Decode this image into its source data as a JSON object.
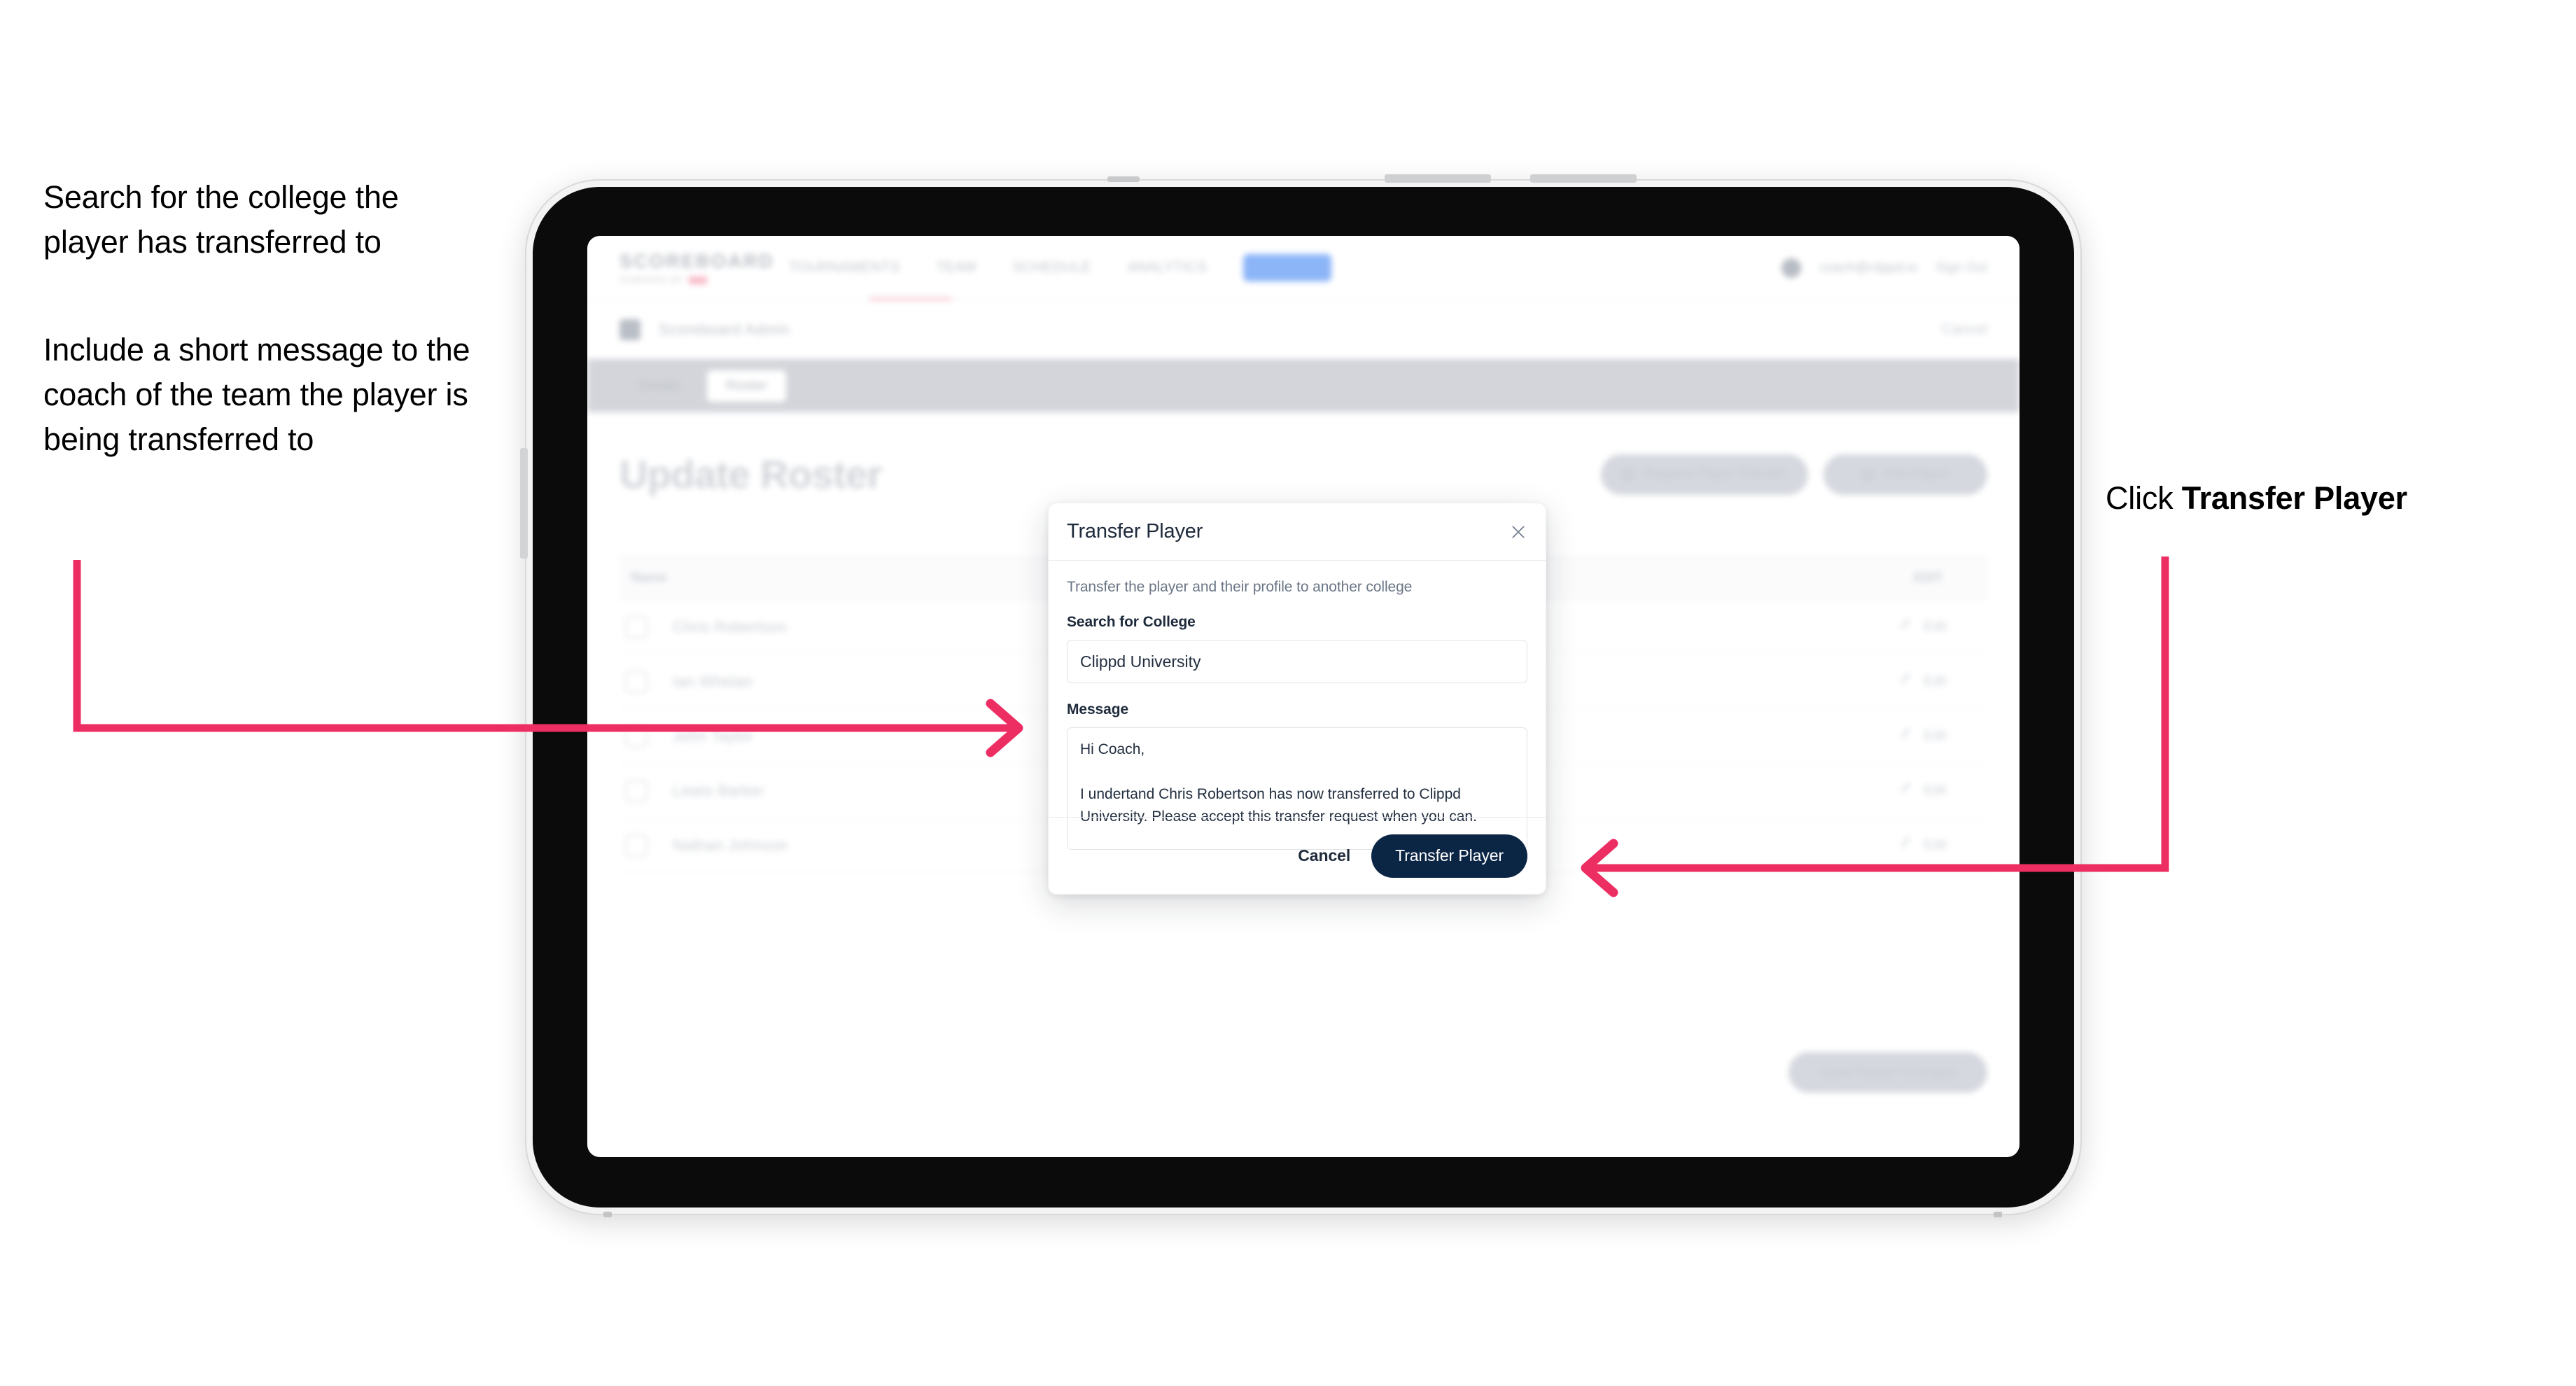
{
  "annotations": {
    "left_1": "Search for the college the player has transferred to",
    "left_2": "Include a short message to the coach of the team the player is being transferred to",
    "right_prefix": "Click ",
    "right_bold": "Transfer Player"
  },
  "colors": {
    "arrow": "#ED2E63",
    "primary_button": "#0B2545",
    "modal_title": "#1E2A3B",
    "muted_text": "#6B7686"
  },
  "app": {
    "logo": "SCOREBOARD",
    "logo_sub": "POWERED BY",
    "nav_items": [
      "TOURNAMENTS",
      "TEAM",
      "SCHEDULE",
      "ANALYTICS",
      "ROSTER"
    ],
    "user_email": "coach@clippd.io",
    "sign_out": "Sign Out",
    "breadcrumb": "Scoreboard Admin",
    "sub_cancel": "Cancel",
    "tabs": [
      "Details",
      "Roster"
    ],
    "active_tab": "Roster",
    "page_title": "Update Roster",
    "actions": [
      {
        "label": "Request Player Transfer"
      },
      {
        "label": "Add Player"
      }
    ],
    "table": {
      "headers": [
        "Name",
        "EDIT"
      ],
      "rows": [
        {
          "name": "Chris Robertson",
          "edit": "Edit"
        },
        {
          "name": "Ian Whelan",
          "edit": "Edit"
        },
        {
          "name": "John Taylor",
          "edit": "Edit"
        },
        {
          "name": "Lewis Barker",
          "edit": "Edit"
        },
        {
          "name": "Nathan Johnson",
          "edit": "Edit"
        }
      ]
    },
    "footer_button": "Save Roster Changes"
  },
  "modal": {
    "title": "Transfer Player",
    "close_icon": "close-icon",
    "description": "Transfer the player and their profile to another college",
    "search_label": "Search for College",
    "search_value": "Clippd University",
    "search_placeholder": "Search for College",
    "message_label": "Message",
    "message_value": "Hi Coach,\n\nI undertand Chris Robertson has now transferred to Clippd University. Please accept this transfer request when you can.",
    "message_placeholder": "Message",
    "cancel_label": "Cancel",
    "submit_label": "Transfer Player"
  }
}
